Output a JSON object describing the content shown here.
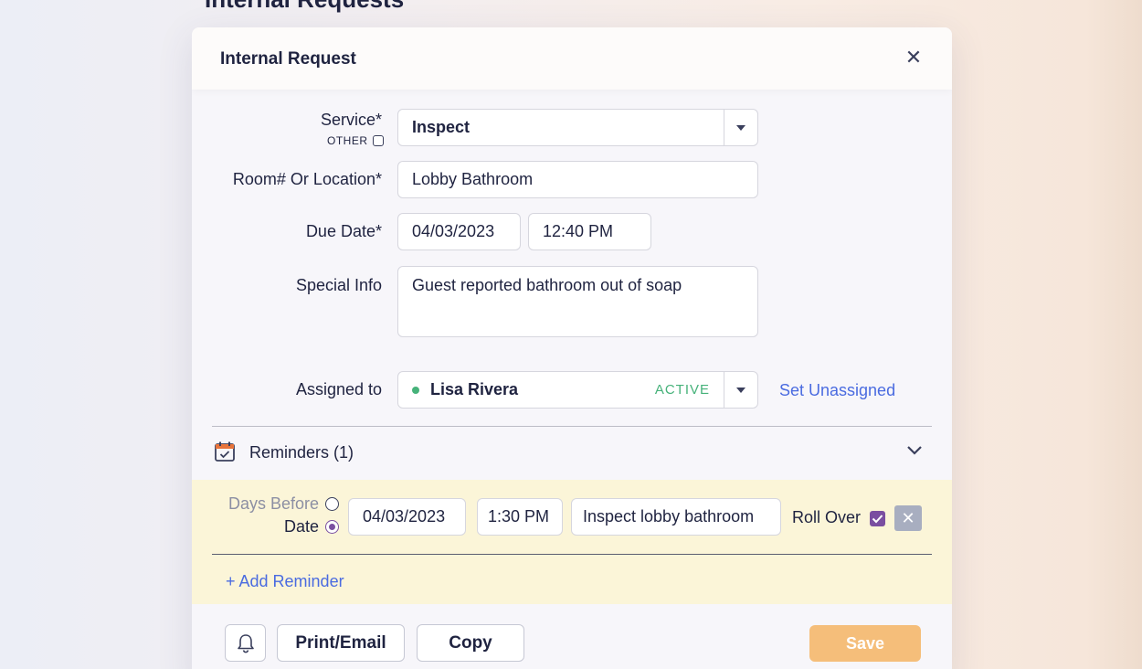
{
  "page": {
    "title": "Internal Requests"
  },
  "modal": {
    "title": "Internal Request"
  },
  "form": {
    "service": {
      "label": "Service*",
      "other_label": "OTHER",
      "value": "Inspect"
    },
    "location": {
      "label": "Room# Or Location*",
      "value": "Lobby Bathroom"
    },
    "due_date": {
      "label": "Due Date*",
      "date": "04/03/2023",
      "time": "12:40 PM"
    },
    "special_info": {
      "label": "Special Info",
      "value": "Guest reported bathroom out of soap"
    },
    "assigned": {
      "label": "Assigned to",
      "name": "Lisa Rivera",
      "status": "ACTIVE",
      "set_unassigned": "Set Unassigned"
    }
  },
  "reminders": {
    "title": "Reminders (1)",
    "items": [
      {
        "option_days_before": "Days Before",
        "option_date": "Date",
        "selected_option": "Date",
        "date": "04/03/2023",
        "time": "1:30 PM",
        "message": "Inspect lobby bathroom",
        "roll_over_label": "Roll Over",
        "roll_over_checked": true
      }
    ],
    "add_label": "+ Add Reminder"
  },
  "footer": {
    "print_label": "Print/Email",
    "copy_label": "Copy",
    "save_label": "Save"
  },
  "colors": {
    "accent_link": "#4a6be0",
    "status_active": "#46b27a",
    "save_button": "#f5be7a",
    "reminder_bg": "#fbf5d8",
    "checkbox": "#7a4ea0"
  },
  "icons": {
    "close": "close-icon",
    "calendar": "calendar-check-icon",
    "chevron": "chevron-down-icon",
    "bell": "bell-icon"
  }
}
